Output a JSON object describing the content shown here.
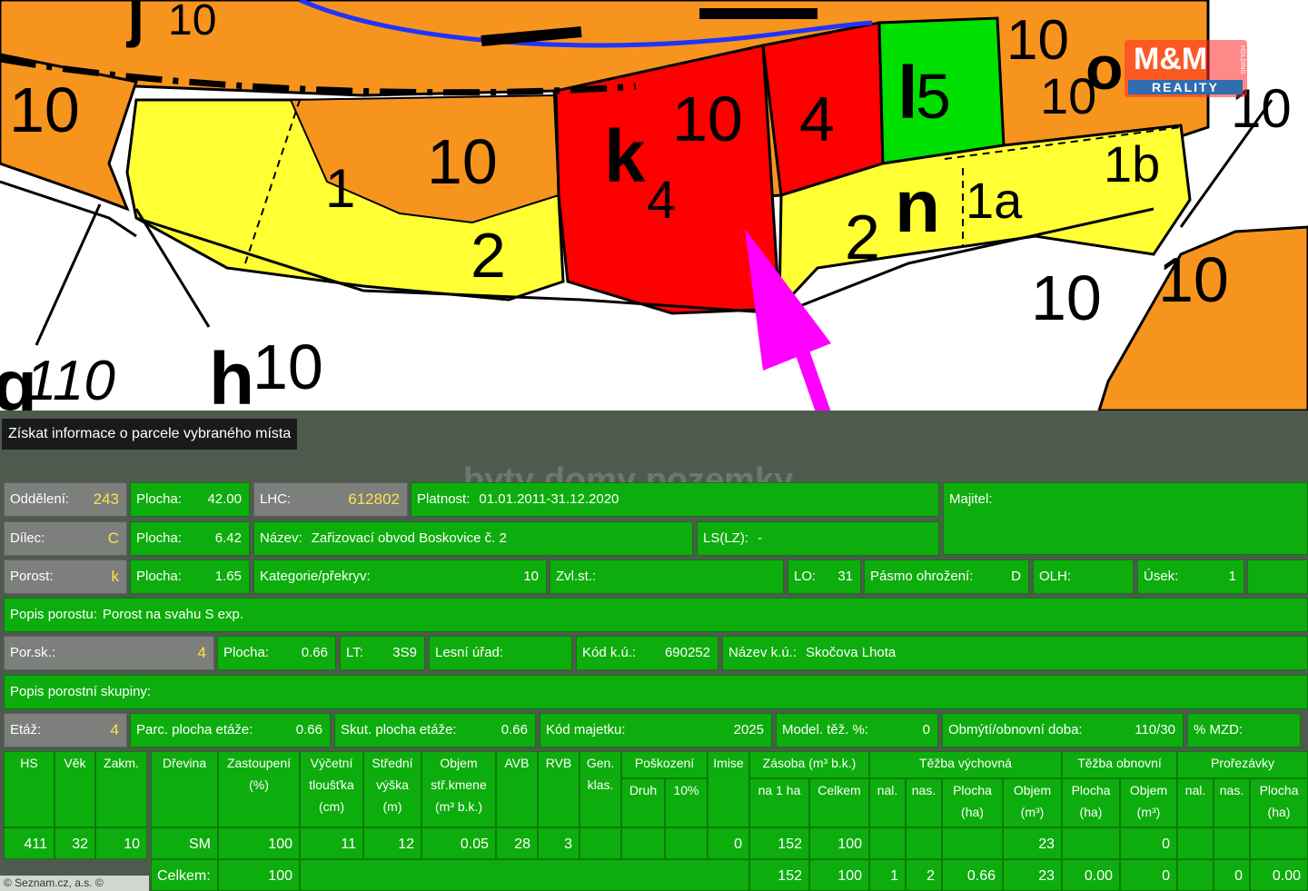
{
  "map": {
    "labels": {
      "j": "j",
      "j10": "10",
      "top_left_10": "10",
      "k": "k",
      "k_sub": "4",
      "k_num": "10",
      "red_right": "4",
      "l": "l",
      "l_num": "5",
      "o_10": "10",
      "o": "o",
      "o_10b": "10",
      "right_10": "10",
      "one": "1",
      "center_10": "10",
      "two_left": "2",
      "n": "n",
      "two_right": "2",
      "one_a": "1a",
      "one_b": "1b",
      "bottom_10": "10",
      "bottom_right_10": "10",
      "g": "g",
      "g_num": "110",
      "h": "h",
      "h_num": "10"
    },
    "colors": {
      "orange": "#f7941d",
      "yellow": "#ffff00",
      "red": "#ff0000",
      "green": "#00e000",
      "arrow": "#ff00ff"
    },
    "logo": {
      "top": "M&M",
      "bottom": "REALITY",
      "side": "HOLDING"
    },
    "watermark": "byty domy pozemky"
  },
  "panel": {
    "title": "Získat informace o parcele vybraného místa",
    "row1": {
      "oddeleni_label": "Oddělení:",
      "oddeleni": "243",
      "plocha_label": "Plocha:",
      "plocha": "42.00",
      "lhc_label": "LHC:",
      "lhc": "612802",
      "platnost_label": "Platnost:",
      "platnost": "01.01.2011-31.12.2020",
      "majitel_label": "Majitel:"
    },
    "row2": {
      "dilec_label": "Dílec:",
      "dilec": "C",
      "plocha_label": "Plocha:",
      "plocha": "6.42",
      "nazev_label": "Název:",
      "nazev": "Zařizovací obvod Boskovice č. 2",
      "ls_label": "LS(LZ):",
      "ls": "-"
    },
    "row3": {
      "porost_label": "Porost:",
      "porost": "k",
      "plocha_label": "Plocha:",
      "plocha": "1.65",
      "kategorie_label": "Kategorie/překryv:",
      "kategorie": "10",
      "zvl_label": "Zvl.st.:",
      "lo_label": "LO:",
      "lo": "31",
      "pasmo_label": "Pásmo ohrožení:",
      "pasmo": "D",
      "olh_label": "OLH:",
      "usek_label": "Úsek:",
      "usek": "1"
    },
    "row4": {
      "popis_label": "Popis porostu:",
      "popis": "Porost na svahu S exp."
    },
    "row5": {
      "porsk_label": "Por.sk.:",
      "porsk": "4",
      "plocha_label": "Plocha:",
      "plocha": "0.66",
      "lt_label": "LT:",
      "lt": "3S9",
      "lesni_label": "Lesní úřad:",
      "kod_label": "Kód k.ú.:",
      "kod": "690252",
      "nazevku_label": "Název k.ú.:",
      "nazevku": "Skočova Lhota"
    },
    "row6": {
      "popis_skup_label": "Popis porostní skupiny:"
    },
    "row7": {
      "etaz_label": "Etáž:",
      "etaz": "4",
      "parc_label": "Parc. plocha etáže:",
      "parc": "0.66",
      "skut_label": "Skut. plocha etáže:",
      "skut": "0.66",
      "kodmaj_label": "Kód majetku:",
      "kodmaj": "2025",
      "model_label": "Model. těž. %:",
      "model": "0",
      "obmyti_label": "Obmýtí/obnovní doba:",
      "obmyti": "110/30",
      "mzd_label": "% MZD:"
    },
    "table": {
      "headers": {
        "hs": "HS",
        "vek": "Věk",
        "zakm": "Zakm.",
        "drevina": "Dřevina",
        "zastoupeni": "Zastoupení",
        "zastoupeni_unit": "(%)",
        "vycetni": "Výčetní",
        "vycetni2": "tloušťka",
        "vycetni_unit": "(cm)",
        "stredni": "Střední",
        "stredni2": "výška",
        "stredni_unit": "(m)",
        "objem": "Objem",
        "objem2": "stř.kmene",
        "objem_unit": "(m³ b.k.)",
        "avb": "AVB",
        "rvb": "RVB",
        "gen": "Gen.",
        "gen2": "klas.",
        "poskozeni": "Poškození",
        "druh": "Druh",
        "deset": "10%",
        "imise": "Imise",
        "zasoba": "Zásoba (m³ b.k.)",
        "na1ha": "na 1 ha",
        "celkem": "Celkem",
        "tezba_vych": "Těžba výchovná",
        "nal": "nal.",
        "nas": "nas.",
        "plocha": "Plocha",
        "plocha_unit": "(ha)",
        "objem_h": "Objem",
        "objem_h_unit": "(m³)",
        "tezba_obn": "Těžba obnovní",
        "prorezavky": "Prořezávky"
      },
      "row": {
        "hs": "411",
        "vek": "32",
        "zakm": "10",
        "drevina": "SM",
        "zastoupeni": "100",
        "vycetni": "11",
        "stredni": "12",
        "objem": "0.05",
        "avb": "28",
        "rvb": "3",
        "imise": "0",
        "na1ha": "152",
        "celkem": "100",
        "tv_objem": "23",
        "to_objem": "0"
      },
      "total": {
        "label": "Celkem:",
        "zastoupeni": "100",
        "na1ha": "152",
        "celkem": "100",
        "tv_nal": "1",
        "tv_nas": "2",
        "tv_plocha": "0.66",
        "tv_objem": "23",
        "to_plocha": "0.00",
        "to_objem": "0",
        "pr_nas": "0",
        "pr_plocha": "0.00"
      }
    },
    "copyright": "© Seznam.cz, a.s. ©"
  }
}
